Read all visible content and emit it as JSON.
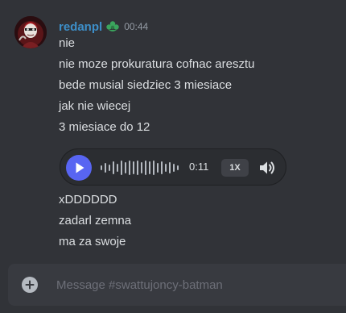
{
  "message": {
    "username": "redanpl",
    "timestamp": "00:44",
    "role_icon": "green-badge-icon",
    "lines_before": [
      "nie",
      "nie moze prokuratura cofnac aresztu",
      "bede musial siedziec 3 miesiace",
      "jak nie wiecej",
      "3 miesiace do 12"
    ],
    "voice_message": {
      "duration": "0:11",
      "speed": "1X",
      "play_icon": "play-icon",
      "volume_icon": "speaker-icon"
    },
    "lines_after": [
      "xDDDDDD",
      "zadarl zemna",
      "ma za swoje"
    ]
  },
  "composer": {
    "placeholder": "Message #swattujoncy-batman",
    "add_icon": "plus-circle-icon"
  },
  "colors": {
    "background": "#313338",
    "username": "#3d8fc9",
    "accent": "#5865f2",
    "text": "#dbdee1",
    "muted": "#949ba4",
    "composer": "#383a40"
  }
}
